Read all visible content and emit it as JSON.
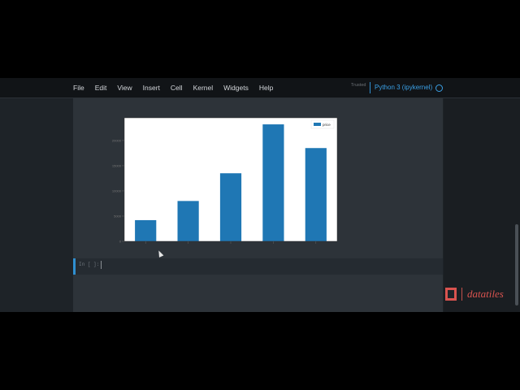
{
  "menu": {
    "items": [
      "File",
      "Edit",
      "View",
      "Insert",
      "Cell",
      "Kernel",
      "Widgets",
      "Help"
    ]
  },
  "kernel": {
    "trusted": "Trusted",
    "name": "Python 3 (ipykernel)"
  },
  "input_cell": {
    "prompt": "In [ ]:"
  },
  "brand": {
    "name": "datatiles"
  },
  "chart_data": {
    "type": "bar",
    "categories": [
      "",
      "",
      "",
      "",
      ""
    ],
    "series": [
      {
        "name": "price",
        "values": [
          4200,
          8000,
          13500,
          23200,
          18500
        ]
      }
    ],
    "ylim": [
      0,
      24500
    ],
    "yticks": [
      0,
      5000,
      10000,
      15000,
      20000
    ],
    "legend": "top-right",
    "bar_color": "#1f77b4"
  }
}
